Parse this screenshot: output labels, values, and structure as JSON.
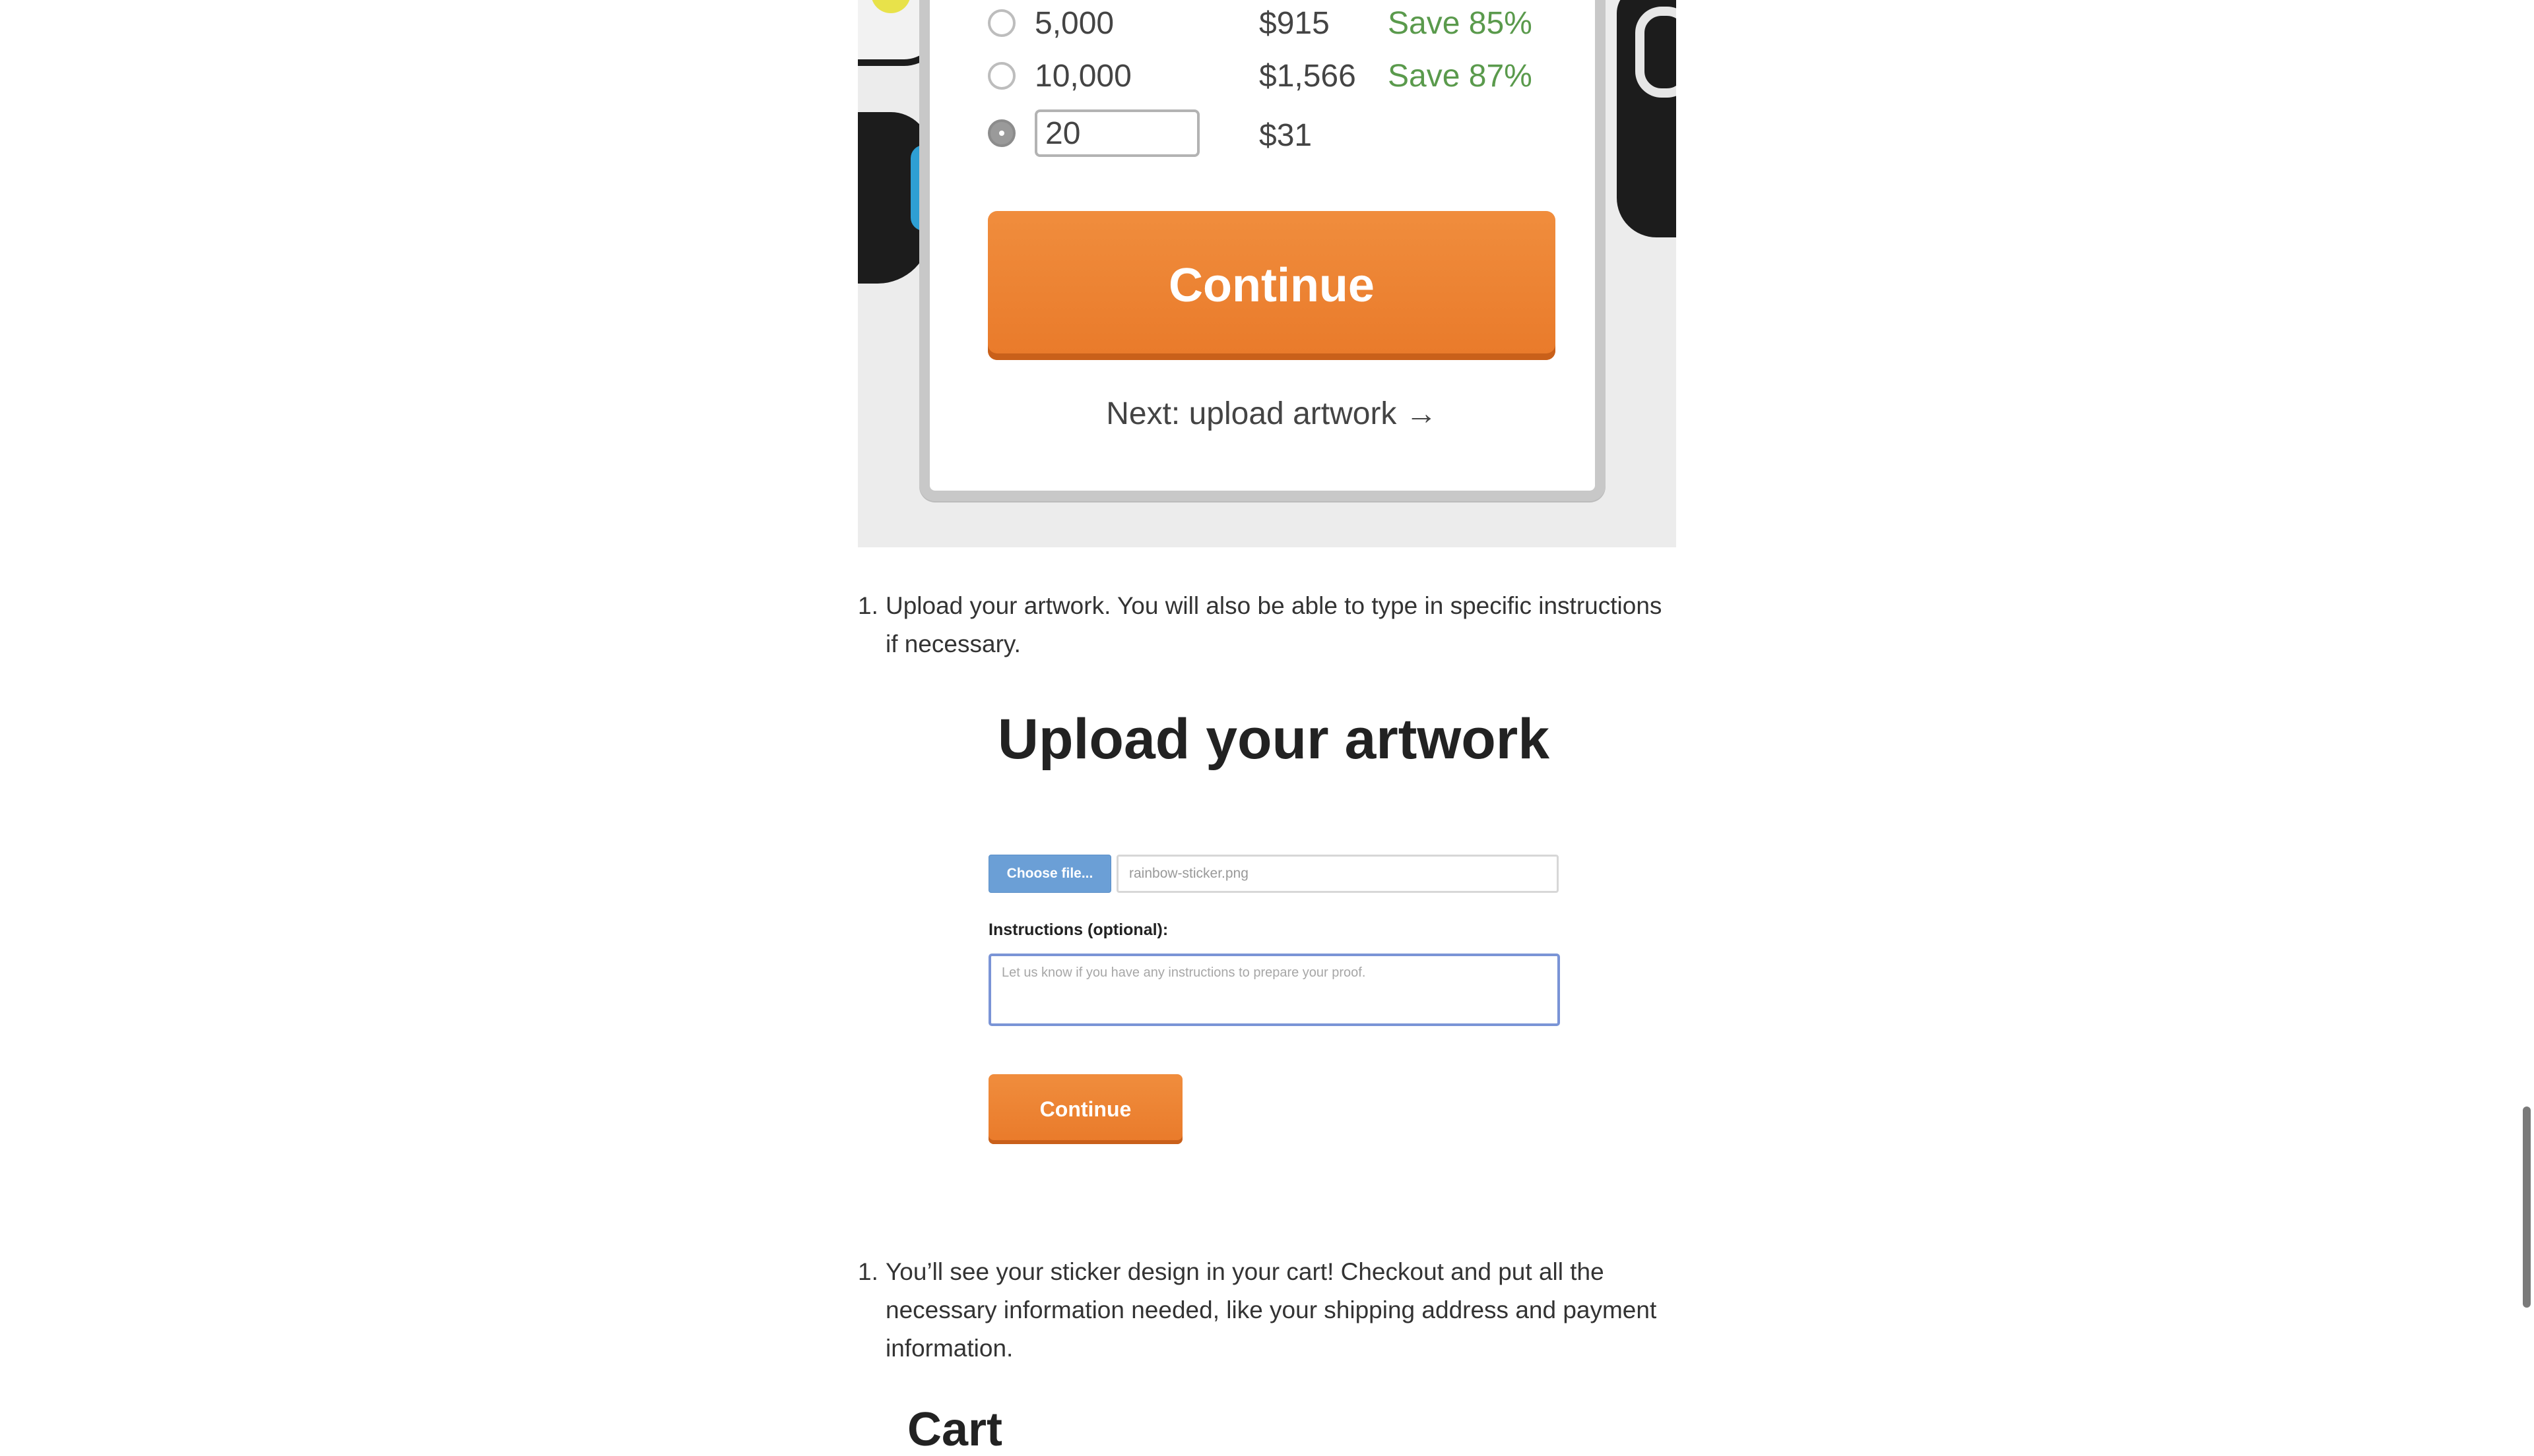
{
  "quantity_picker": {
    "options": [
      {
        "quantity": "5,000",
        "price": "$915",
        "savings": "Save 85%",
        "selected": false
      },
      {
        "quantity": "10,000",
        "price": "$1,566",
        "savings": "Save 87%",
        "selected": false
      }
    ],
    "custom": {
      "quantity": "20",
      "price": "$31",
      "selected": true
    },
    "continue_label": "Continue",
    "next_label": "Next: upload artwork →"
  },
  "steps": {
    "upload": {
      "number": "1.",
      "text": "Upload your artwork. You will also be able to type in specific instructions if necessary."
    },
    "cart": {
      "number": "1.",
      "text": "You’ll see your sticker design in your cart! Checkout and put all the necessary information needed, like your shipping address and payment information."
    }
  },
  "upload_form": {
    "title": "Upload your artwork",
    "choose_file_label": "Choose file...",
    "file_name": "rainbow-sticker.png",
    "instructions_label": "Instructions (optional):",
    "instructions_placeholder": "Let us know if you have any instructions to prepare your proof.",
    "continue_label": "Continue"
  },
  "next_heading_partial": "Cart",
  "colors": {
    "accent_orange": "#eb822f",
    "save_green": "#5a9a4c",
    "choose_blue": "#6b9fd6"
  }
}
